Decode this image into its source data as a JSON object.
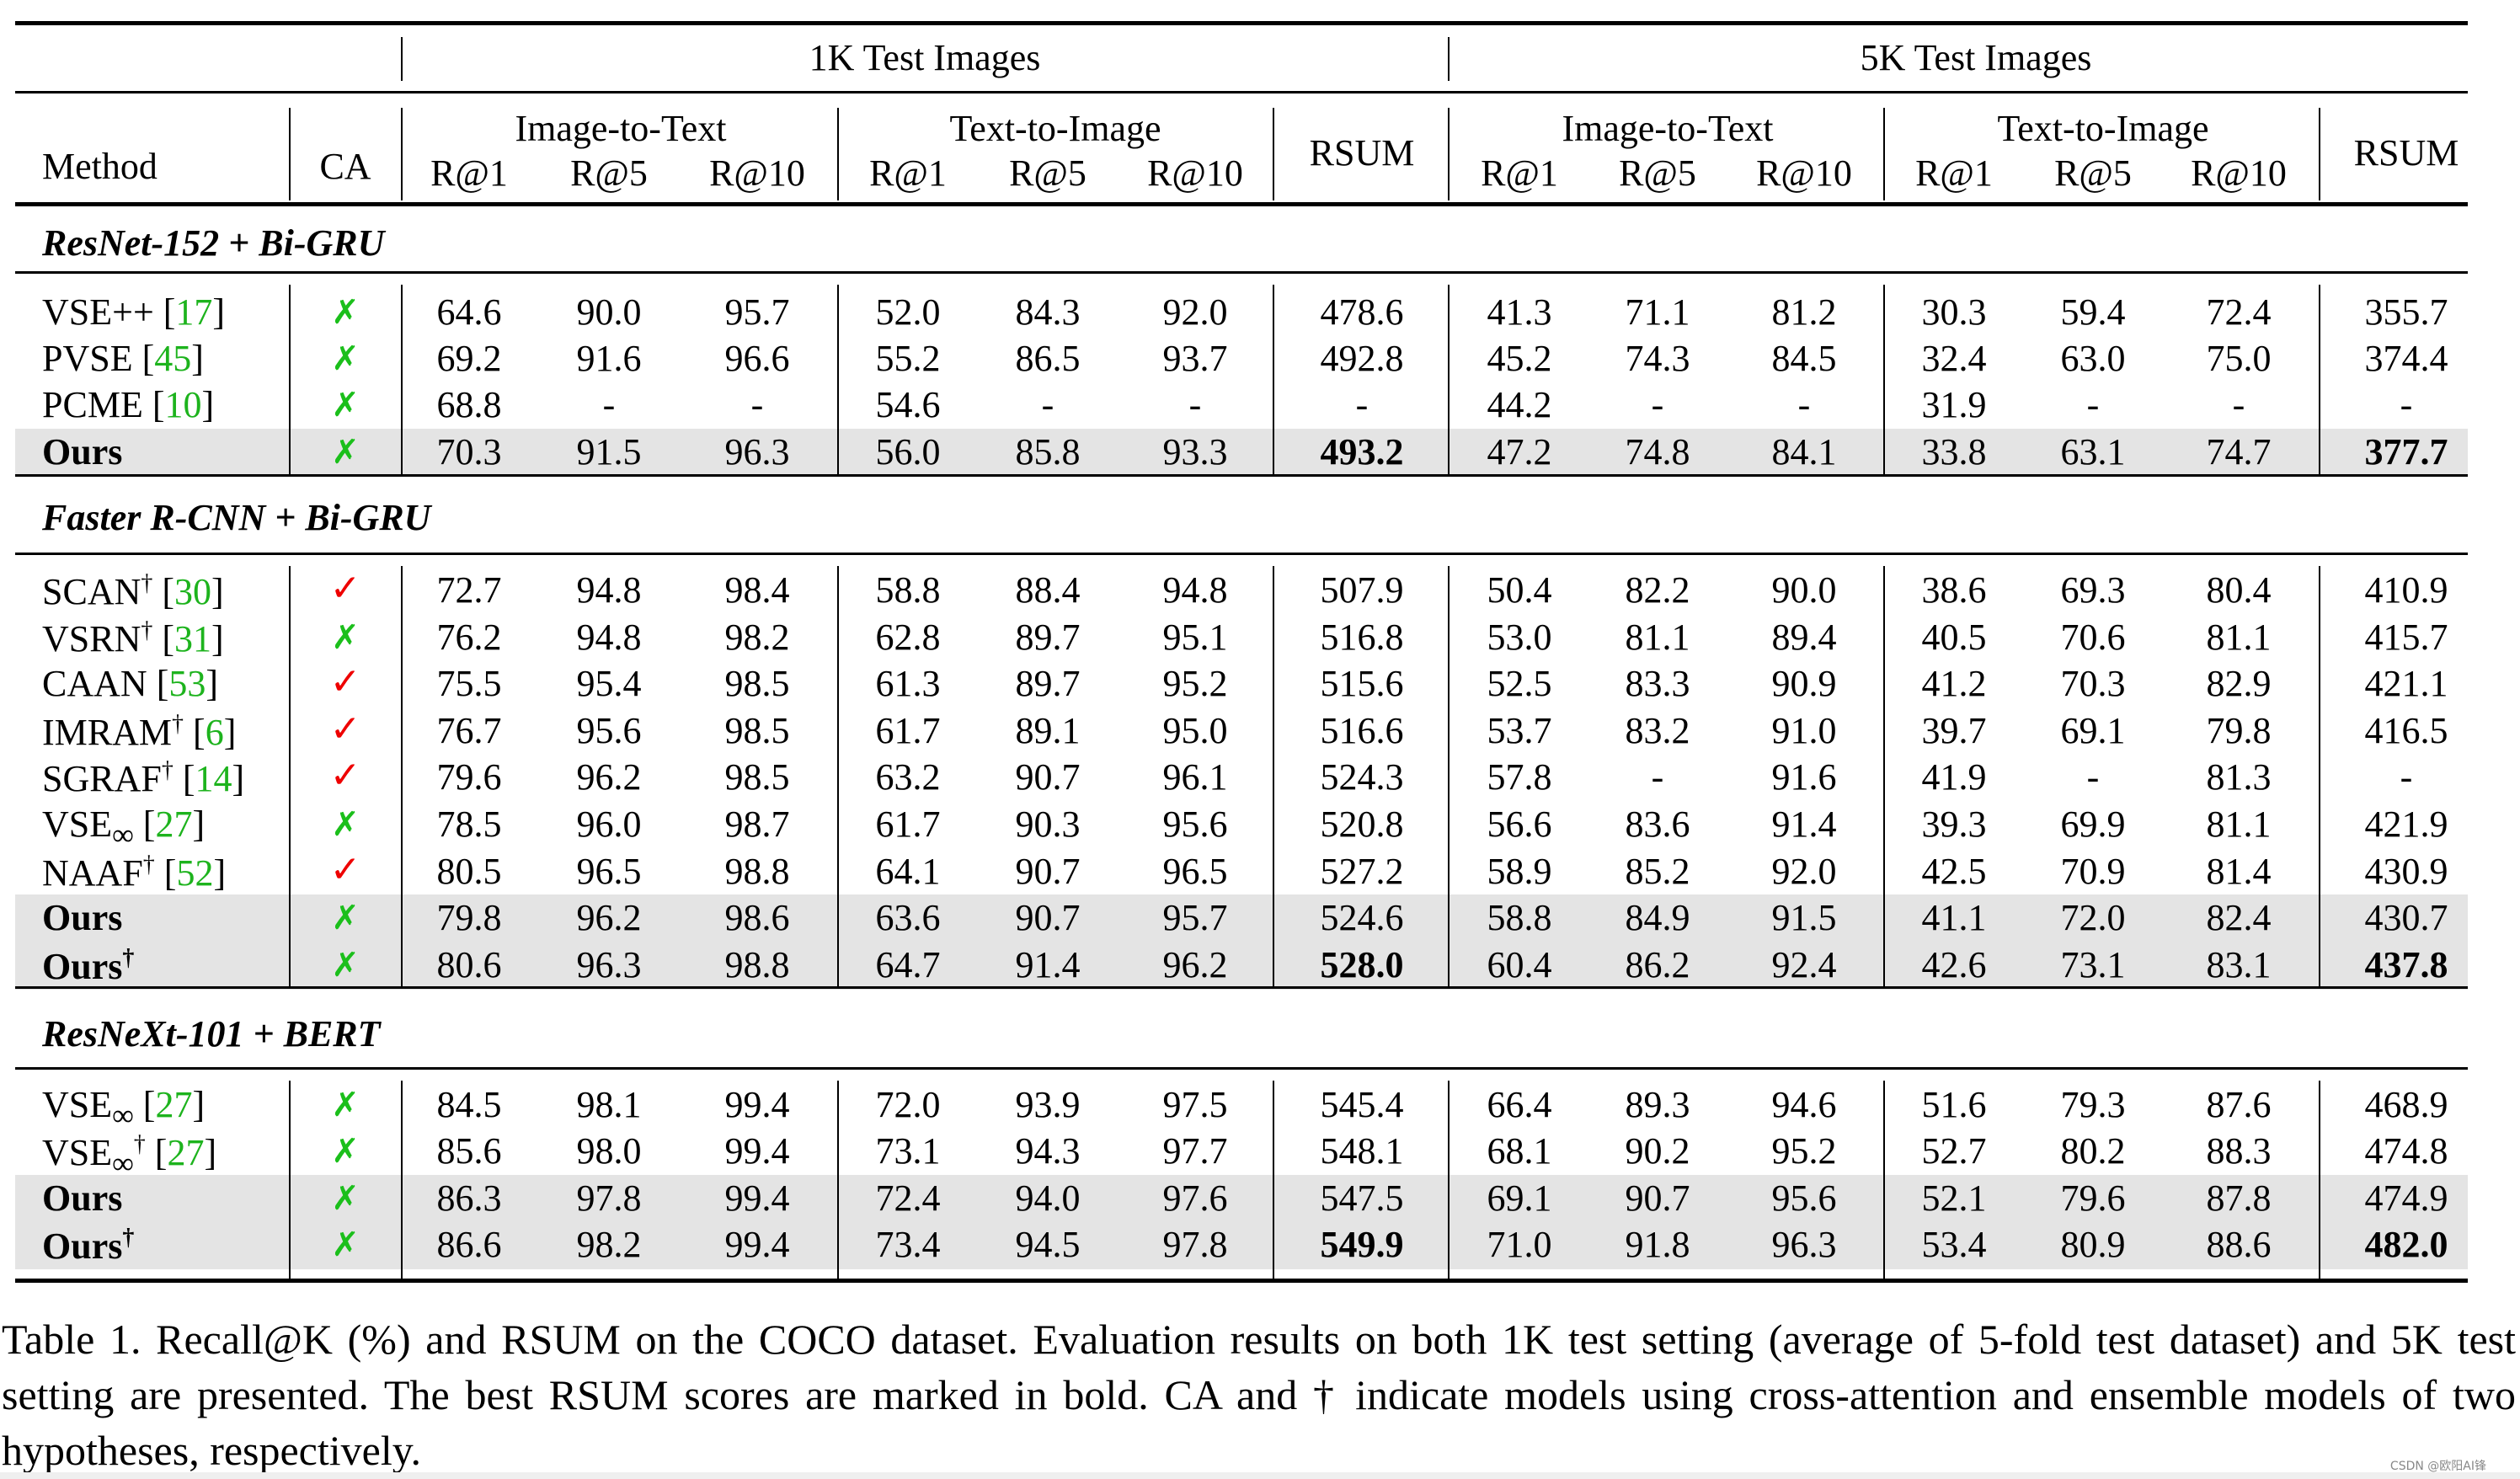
{
  "table": {
    "super_headers": [
      "1K Test Images",
      "5K Test Images"
    ],
    "method_header": "Method",
    "ca_header": "CA",
    "direction_headers": [
      "Image-to-Text",
      "Text-to-Image"
    ],
    "metric_headers": [
      "R@1",
      "R@5",
      "R@10"
    ],
    "rsum_header": "RSUM",
    "groups": [
      {
        "title": "ResNet-152 + Bi-GRU",
        "rows": [
          {
            "name": "VSE++",
            "sub": "",
            "dagger": false,
            "ref": "17",
            "ca": false,
            "ours": false,
            "k1": [
              "64.6",
              "90.0",
              "95.7",
              "52.0",
              "84.3",
              "92.0",
              "478.6"
            ],
            "k5": [
              "41.3",
              "71.1",
              "81.2",
              "30.3",
              "59.4",
              "72.4",
              "355.7"
            ],
            "bold_rsum": [
              false,
              false
            ]
          },
          {
            "name": "PVSE",
            "sub": "",
            "dagger": false,
            "ref": "45",
            "ca": false,
            "ours": false,
            "k1": [
              "69.2",
              "91.6",
              "96.6",
              "55.2",
              "86.5",
              "93.7",
              "492.8"
            ],
            "k5": [
              "45.2",
              "74.3",
              "84.5",
              "32.4",
              "63.0",
              "75.0",
              "374.4"
            ],
            "bold_rsum": [
              false,
              false
            ]
          },
          {
            "name": "PCME",
            "sub": "",
            "dagger": false,
            "ref": "10",
            "ca": false,
            "ours": false,
            "k1": [
              "68.8",
              "-",
              "-",
              "54.6",
              "-",
              "-",
              "-"
            ],
            "k5": [
              "44.2",
              "-",
              "-",
              "31.9",
              "-",
              "-",
              "-"
            ],
            "bold_rsum": [
              false,
              false
            ]
          },
          {
            "name": "Ours",
            "sub": "",
            "dagger": false,
            "ref": "",
            "ca": false,
            "ours": true,
            "k1": [
              "70.3",
              "91.5",
              "96.3",
              "56.0",
              "85.8",
              "93.3",
              "493.2"
            ],
            "k5": [
              "47.2",
              "74.8",
              "84.1",
              "33.8",
              "63.1",
              "74.7",
              "377.7"
            ],
            "bold_rsum": [
              true,
              true
            ]
          }
        ]
      },
      {
        "title": "Faster R-CNN + Bi-GRU",
        "rows": [
          {
            "name": "SCAN",
            "sub": "",
            "dagger": true,
            "ref": "30",
            "ca": true,
            "ours": false,
            "k1": [
              "72.7",
              "94.8",
              "98.4",
              "58.8",
              "88.4",
              "94.8",
              "507.9"
            ],
            "k5": [
              "50.4",
              "82.2",
              "90.0",
              "38.6",
              "69.3",
              "80.4",
              "410.9"
            ],
            "bold_rsum": [
              false,
              false
            ]
          },
          {
            "name": "VSRN",
            "sub": "",
            "dagger": true,
            "ref": "31",
            "ca": false,
            "ours": false,
            "k1": [
              "76.2",
              "94.8",
              "98.2",
              "62.8",
              "89.7",
              "95.1",
              "516.8"
            ],
            "k5": [
              "53.0",
              "81.1",
              "89.4",
              "40.5",
              "70.6",
              "81.1",
              "415.7"
            ],
            "bold_rsum": [
              false,
              false
            ]
          },
          {
            "name": "CAAN",
            "sub": "",
            "dagger": false,
            "ref": "53",
            "ca": true,
            "ours": false,
            "k1": [
              "75.5",
              "95.4",
              "98.5",
              "61.3",
              "89.7",
              "95.2",
              "515.6"
            ],
            "k5": [
              "52.5",
              "83.3",
              "90.9",
              "41.2",
              "70.3",
              "82.9",
              "421.1"
            ],
            "bold_rsum": [
              false,
              false
            ]
          },
          {
            "name": "IMRAM",
            "sub": "",
            "dagger": true,
            "ref": "6",
            "ca": true,
            "ours": false,
            "k1": [
              "76.7",
              "95.6",
              "98.5",
              "61.7",
              "89.1",
              "95.0",
              "516.6"
            ],
            "k5": [
              "53.7",
              "83.2",
              "91.0",
              "39.7",
              "69.1",
              "79.8",
              "416.5"
            ],
            "bold_rsum": [
              false,
              false
            ]
          },
          {
            "name": "SGRAF",
            "sub": "",
            "dagger": true,
            "ref": "14",
            "ca": true,
            "ours": false,
            "k1": [
              "79.6",
              "96.2",
              "98.5",
              "63.2",
              "90.7",
              "96.1",
              "524.3"
            ],
            "k5": [
              "57.8",
              "-",
              "91.6",
              "41.9",
              "-",
              "81.3",
              "-"
            ],
            "bold_rsum": [
              false,
              false
            ]
          },
          {
            "name": "VSE",
            "sub": "∞",
            "dagger": false,
            "ref": "27",
            "ca": false,
            "ours": false,
            "k1": [
              "78.5",
              "96.0",
              "98.7",
              "61.7",
              "90.3",
              "95.6",
              "520.8"
            ],
            "k5": [
              "56.6",
              "83.6",
              "91.4",
              "39.3",
              "69.9",
              "81.1",
              "421.9"
            ],
            "bold_rsum": [
              false,
              false
            ]
          },
          {
            "name": "NAAF",
            "sub": "",
            "dagger": true,
            "ref": "52",
            "ca": true,
            "ours": false,
            "k1": [
              "80.5",
              "96.5",
              "98.8",
              "64.1",
              "90.7",
              "96.5",
              "527.2"
            ],
            "k5": [
              "58.9",
              "85.2",
              "92.0",
              "42.5",
              "70.9",
              "81.4",
              "430.9"
            ],
            "bold_rsum": [
              false,
              false
            ]
          },
          {
            "name": "Ours",
            "sub": "",
            "dagger": false,
            "ref": "",
            "ca": false,
            "ours": true,
            "k1": [
              "79.8",
              "96.2",
              "98.6",
              "63.6",
              "90.7",
              "95.7",
              "524.6"
            ],
            "k5": [
              "58.8",
              "84.9",
              "91.5",
              "41.1",
              "72.0",
              "82.4",
              "430.7"
            ],
            "bold_rsum": [
              false,
              false
            ]
          },
          {
            "name": "Ours",
            "sub": "",
            "dagger": true,
            "ref": "",
            "ca": false,
            "ours": true,
            "k1": [
              "80.6",
              "96.3",
              "98.8",
              "64.7",
              "91.4",
              "96.2",
              "528.0"
            ],
            "k5": [
              "60.4",
              "86.2",
              "92.4",
              "42.6",
              "73.1",
              "83.1",
              "437.8"
            ],
            "bold_rsum": [
              true,
              true
            ]
          }
        ]
      },
      {
        "title": "ResNeXt-101 + BERT",
        "rows": [
          {
            "name": "VSE",
            "sub": "∞",
            "dagger": false,
            "ref": "27",
            "ca": false,
            "ours": false,
            "k1": [
              "84.5",
              "98.1",
              "99.4",
              "72.0",
              "93.9",
              "97.5",
              "545.4"
            ],
            "k5": [
              "66.4",
              "89.3",
              "94.6",
              "51.6",
              "79.3",
              "87.6",
              "468.9"
            ],
            "bold_rsum": [
              false,
              false
            ]
          },
          {
            "name": "VSE",
            "sub": "∞",
            "dagger": true,
            "ref": "27",
            "ca": false,
            "ours": false,
            "k1": [
              "85.6",
              "98.0",
              "99.4",
              "73.1",
              "94.3",
              "97.7",
              "548.1"
            ],
            "k5": [
              "68.1",
              "90.2",
              "95.2",
              "52.7",
              "80.2",
              "88.3",
              "474.8"
            ],
            "bold_rsum": [
              false,
              false
            ]
          },
          {
            "name": "Ours",
            "sub": "",
            "dagger": false,
            "ref": "",
            "ca": false,
            "ours": true,
            "k1": [
              "86.3",
              "97.8",
              "99.4",
              "72.4",
              "94.0",
              "97.6",
              "547.5"
            ],
            "k5": [
              "69.1",
              "90.7",
              "95.6",
              "52.1",
              "79.6",
              "87.8",
              "474.9"
            ],
            "bold_rsum": [
              false,
              false
            ]
          },
          {
            "name": "Ours",
            "sub": "",
            "dagger": true,
            "ref": "",
            "ca": false,
            "ours": true,
            "k1": [
              "86.6",
              "98.2",
              "99.4",
              "73.4",
              "94.5",
              "97.8",
              "549.9"
            ],
            "k5": [
              "71.0",
              "91.8",
              "96.3",
              "53.4",
              "80.9",
              "88.6",
              "482.0"
            ],
            "bold_rsum": [
              true,
              true
            ]
          }
        ]
      }
    ],
    "ca_symbols": {
      "yes": "✓",
      "no": "✗"
    },
    "dagger_symbol": "†",
    "colors": {
      "ref": "#1db31d",
      "ca_no": "#1bbf1b",
      "ca_yes": "#ee0000",
      "highlight_row": "#e4e4e4"
    }
  },
  "caption": "Table 1. Recall@K (%) and RSUM on the COCO dataset. Evaluation results on both 1K test setting (average of 5-fold test dataset) and 5K test setting are presented. The best RSUM scores are marked in bold. CA and † indicate models using cross-attention and ensemble models of two hypotheses, respectively.",
  "watermark": "CSDN @欧阳AI锋"
}
